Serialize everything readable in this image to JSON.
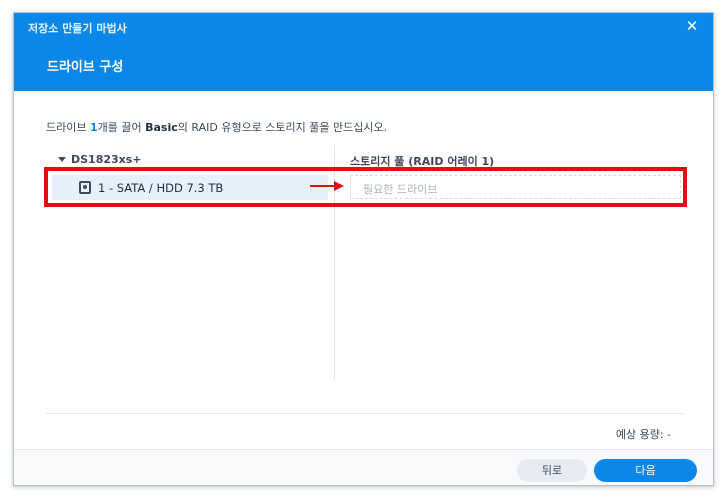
{
  "window": {
    "title": "저장소 만들기 마법사",
    "close_symbol": "✕"
  },
  "step": {
    "title": "드라이브 구성"
  },
  "description": {
    "part1": "드라이브 ",
    "count": "1",
    "part2": "개를 끌어 ",
    "type": "Basic",
    "part3": "의 RAID 유형으로 스토리지 풀을 만드십시오."
  },
  "device_tree": {
    "device_name": "DS1823xs+",
    "drives": [
      {
        "label": "1 - SATA / HDD 7.3 TB",
        "icon": "hdd-icon"
      }
    ]
  },
  "storage_pool": {
    "header": "스토리지 풀 (RAID 어레이 1)",
    "placeholder": "필요한 드라이브"
  },
  "summary": {
    "capacity_label": "예상 용량: -"
  },
  "buttons": {
    "back": "뒤로",
    "next": "다음"
  },
  "colors": {
    "accent": "#0a87e8",
    "highlight_box": "#e01010",
    "row_selected": "#e6f0fb"
  }
}
